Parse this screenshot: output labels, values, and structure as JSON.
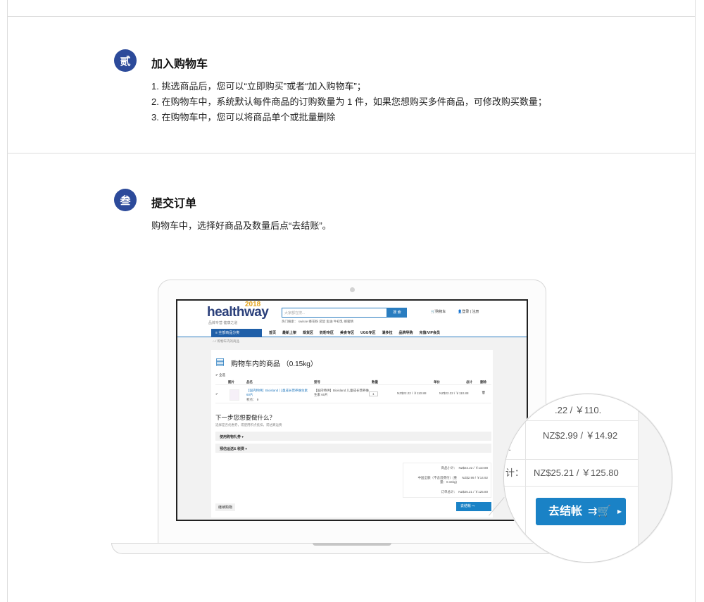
{
  "step2": {
    "badge": "贰",
    "title": "加入购物车",
    "lines": [
      "1. 挑选商品后，您可以“立即购买”或者“加入购物车”；",
      "2. 在购物车中，系统默认每件商品的订购数量为 1 件，如果您想购买多件商品，可修改购买数量；",
      "3. 在购物车中，您可以将商品单个或批量删除"
    ]
  },
  "step3": {
    "badge": "叁",
    "title": "提交订单",
    "line": "购物车中，选择好商品及数量后点“去结账”。"
  },
  "site": {
    "logo": "healthway",
    "logo_year": "2018",
    "logo_sub": "品牌专营 健康之道",
    "search_placeholder": "大家都在搜...",
    "search_button": "搜 索",
    "hot_search": "热门搜索：  swisse    蜂花粉    袋鼠    鱼油    牛初乳    蜂蜜精",
    "cart_label": "购物车",
    "login_label": "登录 | 注册",
    "nav_all": "≡ 全部商品分类",
    "nav_items": [
      "首页",
      "最新上架",
      "规货区",
      "奶粉专区",
      "美食专区",
      "UGG专区",
      "满多拉",
      "品牌导购",
      "充值/VIP会员"
    ],
    "breadcrumb": "⌂ / 购物车内的商品"
  },
  "cart": {
    "title": "购物车内的商品 （0.15kg）",
    "select_all": "✔ 全选",
    "headers": {
      "image": "图片",
      "name": "品名",
      "model": "型号",
      "qty": "数量",
      "price": "单价",
      "total": "总计",
      "delete": "删除"
    },
    "item": {
      "name": "【国内特供】Bioisland 儿童成长营养维生素 60片",
      "points": "积点：  9",
      "model": "【国内特供】Bioisland 儿童成长营养维生素 60片",
      "qty": "1",
      "price": "NZ$22.22 / ￥110.88",
      "total": "NZ$22.22 / ￥110.88"
    },
    "next_title": "下一步您想要做什么？",
    "next_sub": "选择是否优惠券，或使用积点抵扣，或估算运费",
    "acc_coupon": "使用购物礼券 ▾",
    "acc_shipping": "预估运送& 税费 ▾",
    "summary": {
      "subtotal_label": "商品小计：",
      "subtotal": "NZ$22.22 / ￥110.88",
      "shipping_label": "中国全额（不含首费付）(重量：0.15kg)",
      "shipping": "NZ$2.99 / ￥14.92",
      "total_label": "订单总计：",
      "total": "NZ$25.21 / ￥125.80"
    },
    "continue_label": "继续购物",
    "checkout_label": "去结帐 ⇨"
  },
  "zoom": {
    "top_partial": ".22 / ￥110.",
    "shipping": "NZ$2.99 / ￥14.92",
    "shipping_label_partial": "):",
    "total_label_partial": "计：",
    "total": "NZ$25.21 / ￥125.80",
    "checkout_label": "去结帐",
    "checkout_arrow": "▸"
  }
}
